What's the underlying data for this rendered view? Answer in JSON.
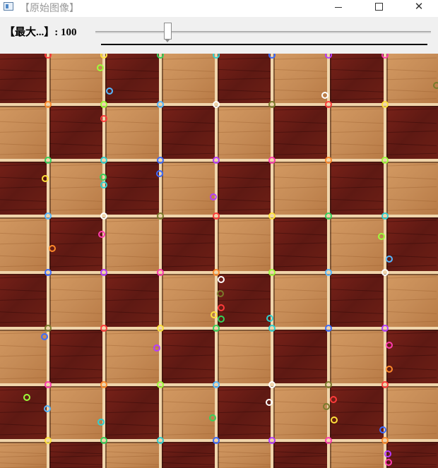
{
  "window": {
    "title": "【原始图像】",
    "controls": {
      "minimize_icon": "minimize-icon",
      "maximize_icon": "maximize-icon",
      "close_icon": "close-icon",
      "close_glyph": "✕"
    }
  },
  "trackbar": {
    "label": "【最大...】: 100",
    "value_fraction": 0.21
  },
  "image": {
    "description_colors": {
      "light_wood": "#c9905a",
      "dark_wood": "#6b1d18",
      "grout": "#f2d4a8"
    }
  }
}
